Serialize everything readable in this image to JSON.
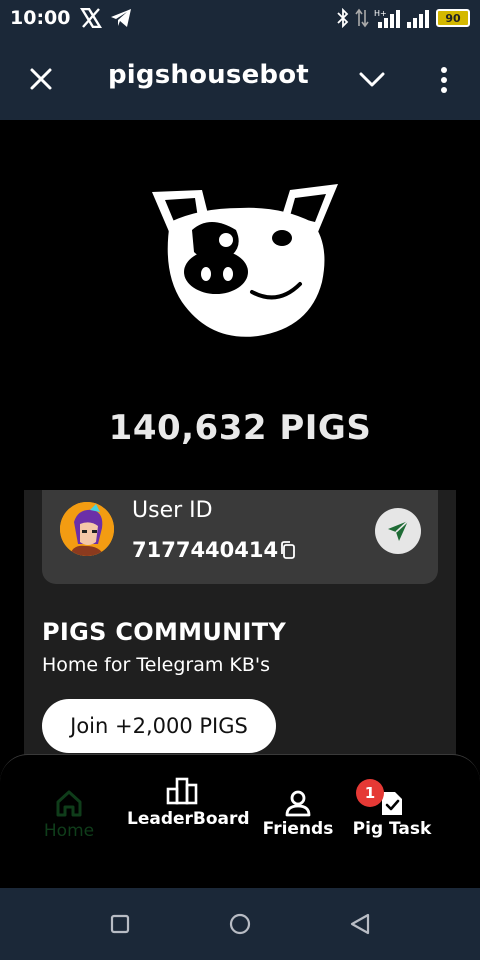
{
  "status_bar": {
    "time": "10:00",
    "battery": "90",
    "left_icons": [
      "x-icon",
      "telegram-icon"
    ],
    "right_icons": [
      "bluetooth-icon",
      "data-arrows-icon",
      "signal-icon",
      "signal-icon",
      "battery-icon"
    ]
  },
  "header": {
    "title": "pigshousebot",
    "icons": [
      "close-icon",
      "chevron-down-icon",
      "more-vertical-icon"
    ]
  },
  "balance": {
    "text": "140,632 PIGS"
  },
  "user_card": {
    "label": "User ID",
    "id": "7177440414"
  },
  "community": {
    "title": "PIGS COMMUNITY",
    "subtitle": "Home for Telegram KB's",
    "join_label": "Join +2,000 PIGS"
  },
  "bottom_nav": {
    "items": [
      {
        "label": "Home",
        "icon": "home-icon",
        "active": true
      },
      {
        "label": "LeaderBoard",
        "icon": "leaderboard-icon",
        "active": false
      },
      {
        "label": "Friends",
        "icon": "user-icon",
        "active": false
      },
      {
        "label": "Pig Task",
        "icon": "task-icon",
        "active": false,
        "badge": "1"
      }
    ]
  },
  "colors": {
    "header_bg": "#1b2838",
    "active_nav": "#0f3d1a",
    "badge": "#e53935",
    "send_icon": "#1e6b35"
  }
}
